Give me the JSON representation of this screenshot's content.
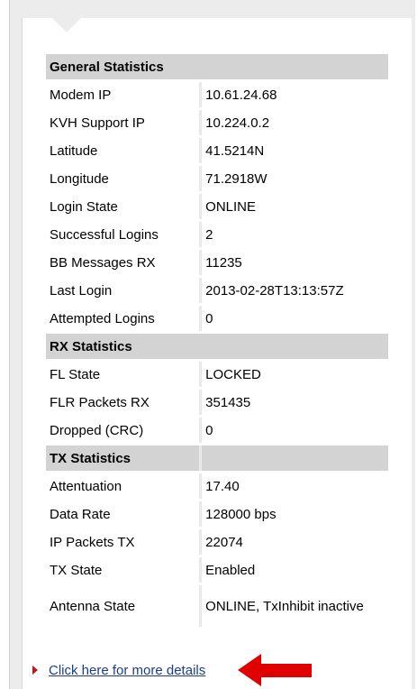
{
  "sections": [
    {
      "title": "General Statistics",
      "rows": [
        {
          "label": "Modem IP",
          "value": "10.61.24.68"
        },
        {
          "label": "KVH Support IP",
          "value": "10.224.0.2"
        },
        {
          "label": "Latitude",
          "value": "41.5214N"
        },
        {
          "label": "Longitude",
          "value": "71.2918W"
        },
        {
          "label": "Login State",
          "value": "ONLINE"
        },
        {
          "label": "Successful Logins",
          "value": "2"
        },
        {
          "label": "BB Messages RX",
          "value": "11235"
        },
        {
          "label": "Last Login",
          "value": "2013-02-28T13:13:57Z"
        },
        {
          "label": "Attempted Logins",
          "value": "0"
        }
      ]
    },
    {
      "title": "RX Statistics",
      "rows": [
        {
          "label": "FL State",
          "value": "LOCKED"
        },
        {
          "label": "FLR Packets RX",
          "value": "351435"
        },
        {
          "label": "Dropped (CRC)",
          "value": "0"
        }
      ]
    },
    {
      "title": "TX Statistics",
      "rows": [
        {
          "label": "Attentuation",
          "value": "17.40"
        },
        {
          "label": "Data Rate",
          "value": "128000 bps"
        },
        {
          "label": "IP Packets TX",
          "value": "22074"
        },
        {
          "label": "TX State",
          "value": "Enabled"
        },
        {
          "label": "Antenna State",
          "value": "ONLINE, TxInhibit inactive"
        }
      ]
    }
  ],
  "footer": {
    "link_label": "Click here for more details"
  },
  "colors": {
    "section_header_bg": "#d3d3d3",
    "link": "#1a3e8c",
    "arrow": "#e00000",
    "bullet": "#c0161a"
  }
}
